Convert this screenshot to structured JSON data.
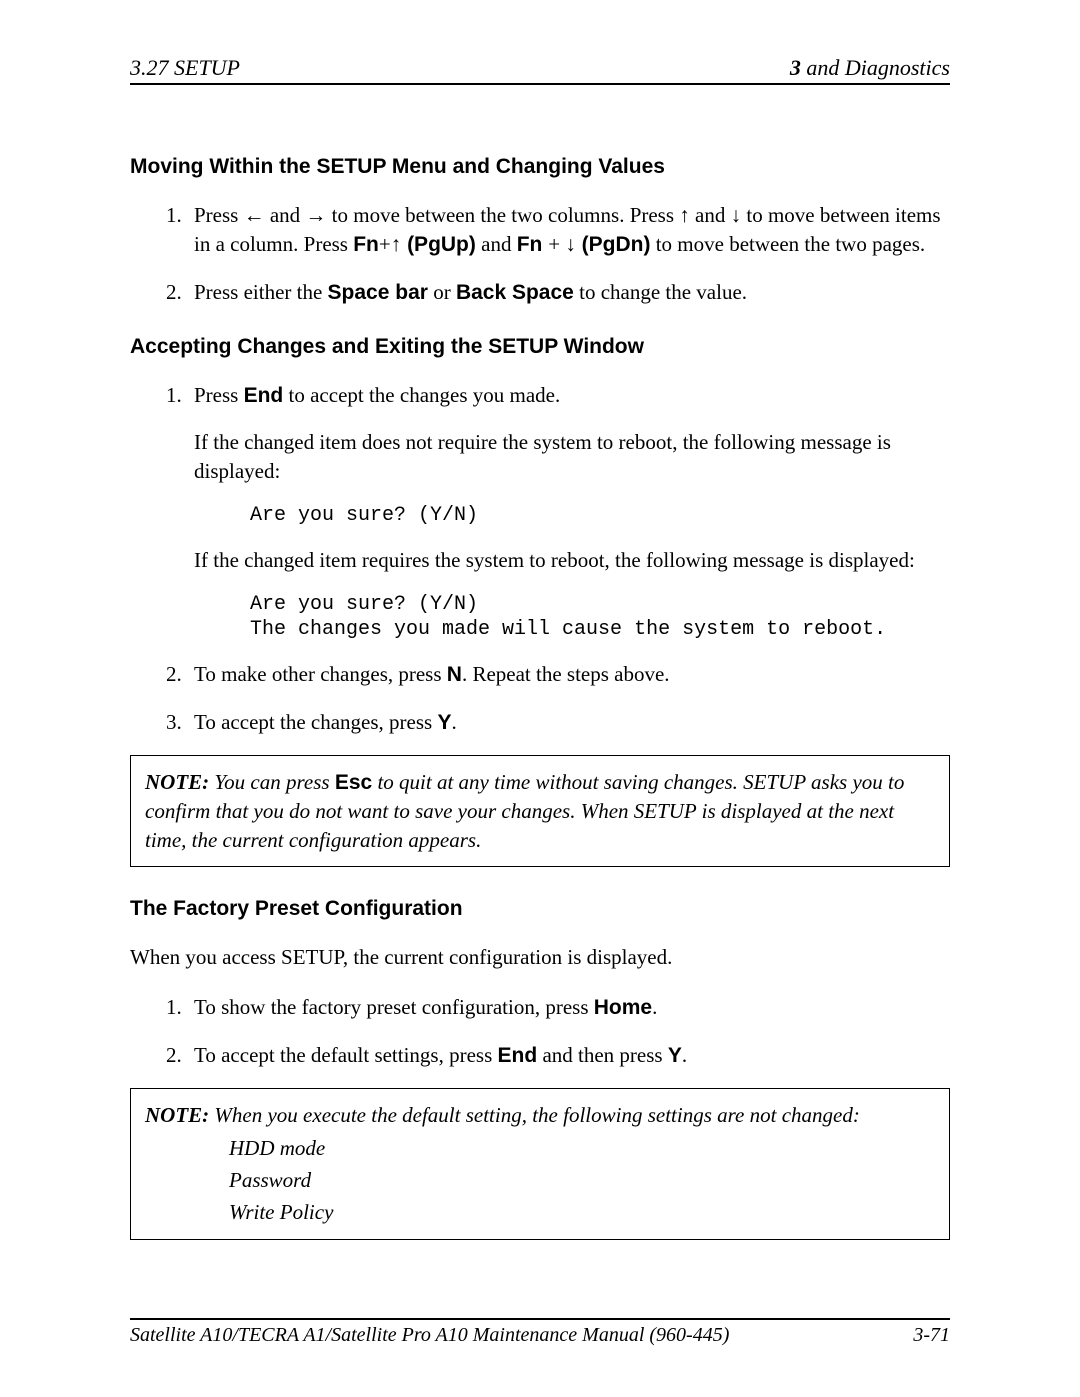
{
  "header": {
    "left": "3.27  SETUP",
    "right_bold": "3",
    "right_rest": " and Diagnostics"
  },
  "sec1": {
    "title": "Moving Within the SETUP Menu and Changing Values",
    "item1": {
      "num": "1.",
      "t1": "Press ",
      "a1": "←",
      "t2": " and ",
      "a2": "→",
      "t3": " to move between the two columns. Press ",
      "a3": "↑",
      "t4": " and ",
      "a4": "↓",
      "t5": " to move between items in a column. Press ",
      "fn1a": "Fn",
      "plus1": "+",
      "a5": "↑",
      "pg1": " (PgUp)",
      "t6": " and ",
      "fn2a": "Fn ",
      "plus2": "+ ",
      "a6": "↓",
      "pg2": " (PgDn)",
      "t7": " to move between the two pages."
    },
    "item2": {
      "num": "2.",
      "t1": "Press either the ",
      "b1": "Space bar",
      "t2": " or ",
      "b2": "Back Space",
      "t3": " to change the value."
    }
  },
  "sec2": {
    "title": "Accepting Changes and Exiting the SETUP Window",
    "item1": {
      "num": "1.",
      "t1": "Press ",
      "b1": "End",
      "t2": " to accept the changes you made."
    },
    "p1": "If the changed item does not require the system to reboot, the following message is displayed:",
    "code1": "Are you sure? (Y/N)",
    "p2": "If the changed item requires the system to reboot, the following message is displayed:",
    "code2": "Are you sure? (Y/N)\nThe changes you made will cause the system to reboot.",
    "item2": {
      "num": "2.",
      "t1": "To make other changes, press ",
      "b1": "N",
      "t2": ". Repeat the steps above."
    },
    "item3": {
      "num": "3.",
      "t1": "To accept the changes, press ",
      "b1": "Y",
      "t2": "."
    }
  },
  "note1": {
    "label": "NOTE:",
    "t1": " You can press ",
    "esc": "Esc",
    "t2": " to quit at any time without saving changes.   SETUP asks you to confirm that you do not want to save your changes. When SETUP is displayed at the next time, the current configuration appears."
  },
  "sec3": {
    "title": "The Factory Preset Configuration",
    "p1": "When you access SETUP, the current configuration is displayed.",
    "item1": {
      "num": "1.",
      "t1": "To show the factory preset configuration, press ",
      "b1": "Home",
      "t2": "."
    },
    "item2": {
      "num": "2.",
      "t1": "To accept the default settings, press ",
      "b1": "End",
      "t2": " and then press ",
      "b2": "Y",
      "t3": "."
    }
  },
  "note2": {
    "label": "NOTE:",
    "t1": " When you execute the default setting, the following settings are not changed:",
    "l1": "HDD mode",
    "l2": "Password",
    "l3": "Write Policy"
  },
  "footer": {
    "left": "Satellite A10/TECRA A1/Satellite Pro A10 Maintenance Manual (960-445)",
    "right": "3-71"
  }
}
